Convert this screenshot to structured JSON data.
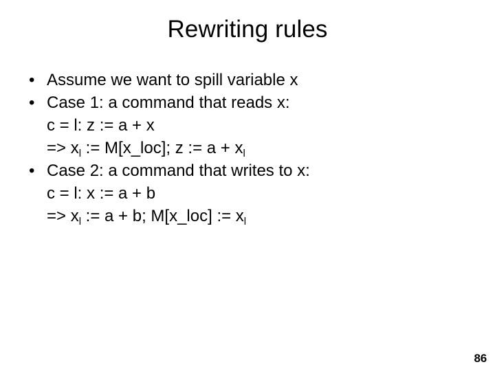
{
  "slide": {
    "title": "Rewriting rules",
    "page_number": "86",
    "text_color": "#000000",
    "background_color": "#ffffff"
  },
  "content": {
    "bullets": [
      {
        "marker": "•",
        "text": "Assume we want to spill variable x",
        "sub_lines": []
      },
      {
        "marker": "•",
        "text": "Case 1: a command that reads x:",
        "sub_lines": [
          {
            "segments": [
              {
                "text": "c = l: z := a + x",
                "subscript": false
              }
            ]
          },
          {
            "segments": [
              {
                "text": "=> x",
                "subscript": false
              },
              {
                "text": "l",
                "subscript": true
              },
              {
                "text": " := M[x_loc]; z := a + x",
                "subscript": false
              },
              {
                "text": "l",
                "subscript": true
              }
            ]
          }
        ]
      },
      {
        "marker": "•",
        "text": "Case 2: a command that writes to x:",
        "sub_lines": [
          {
            "segments": [
              {
                "text": "c = l: x := a + b",
                "subscript": false
              }
            ]
          },
          {
            "segments": [
              {
                "text": "=> x",
                "subscript": false
              },
              {
                "text": "l",
                "subscript": true
              },
              {
                "text": " := a + b; M[x_loc] := x",
                "subscript": false
              },
              {
                "text": "l",
                "subscript": true
              }
            ]
          }
        ]
      }
    ]
  }
}
